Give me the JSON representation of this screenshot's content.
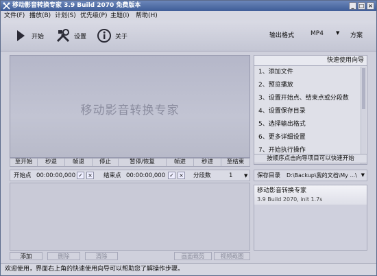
{
  "window": {
    "title": "移动影音转换专家 3.9 Build 2070 免费版本"
  },
  "menu": [
    "文件(F)",
    "播放(B)",
    "计划(S)",
    "优先级(P)",
    "主题(I)",
    "帮助(H)"
  ],
  "toolbar": {
    "start": "开始",
    "settings": "设置",
    "about": "关于",
    "output_format_label": "输出格式",
    "output_format_value": "MP4",
    "scheme": "方案"
  },
  "preview": {
    "watermark": "移动影音转换专家"
  },
  "controls": [
    "至开始",
    "秒退",
    "帧退",
    "停止",
    "暂停/恢复",
    "帧进",
    "秒进",
    "至结束"
  ],
  "points": {
    "start_label": "开始点",
    "start_time": "00:00:00,000",
    "end_label": "结束点",
    "end_time": "00:00:00,000",
    "segments_label": "分段数",
    "segments_value": "1"
  },
  "bottom": {
    "add": "添加",
    "delete": "删除",
    "clear": "清除",
    "crop": "画面裁剪",
    "snapshot": "视频截图"
  },
  "wizard": {
    "header": "快速使用向导",
    "items": [
      "1、添加文件",
      "2、预览播放",
      "3、设置开始点、结束点或分段数",
      "4、设置保存目录",
      "5、选择输出格式",
      "6、更多详细设置",
      "7、开始执行操作"
    ],
    "tip": "按顺序点击向导项目可以快速开始"
  },
  "save": {
    "label": "保存目录",
    "path": "D:\\Backup\\我的文档\\My ...\\"
  },
  "info": {
    "line1": "移动影音转换专家",
    "line2": "3.9 Build 2070, init 1.7s"
  },
  "status": {
    "text": "欢迎使用，界面右上角的快速使用向导可以帮助您了解操作步骤。"
  }
}
